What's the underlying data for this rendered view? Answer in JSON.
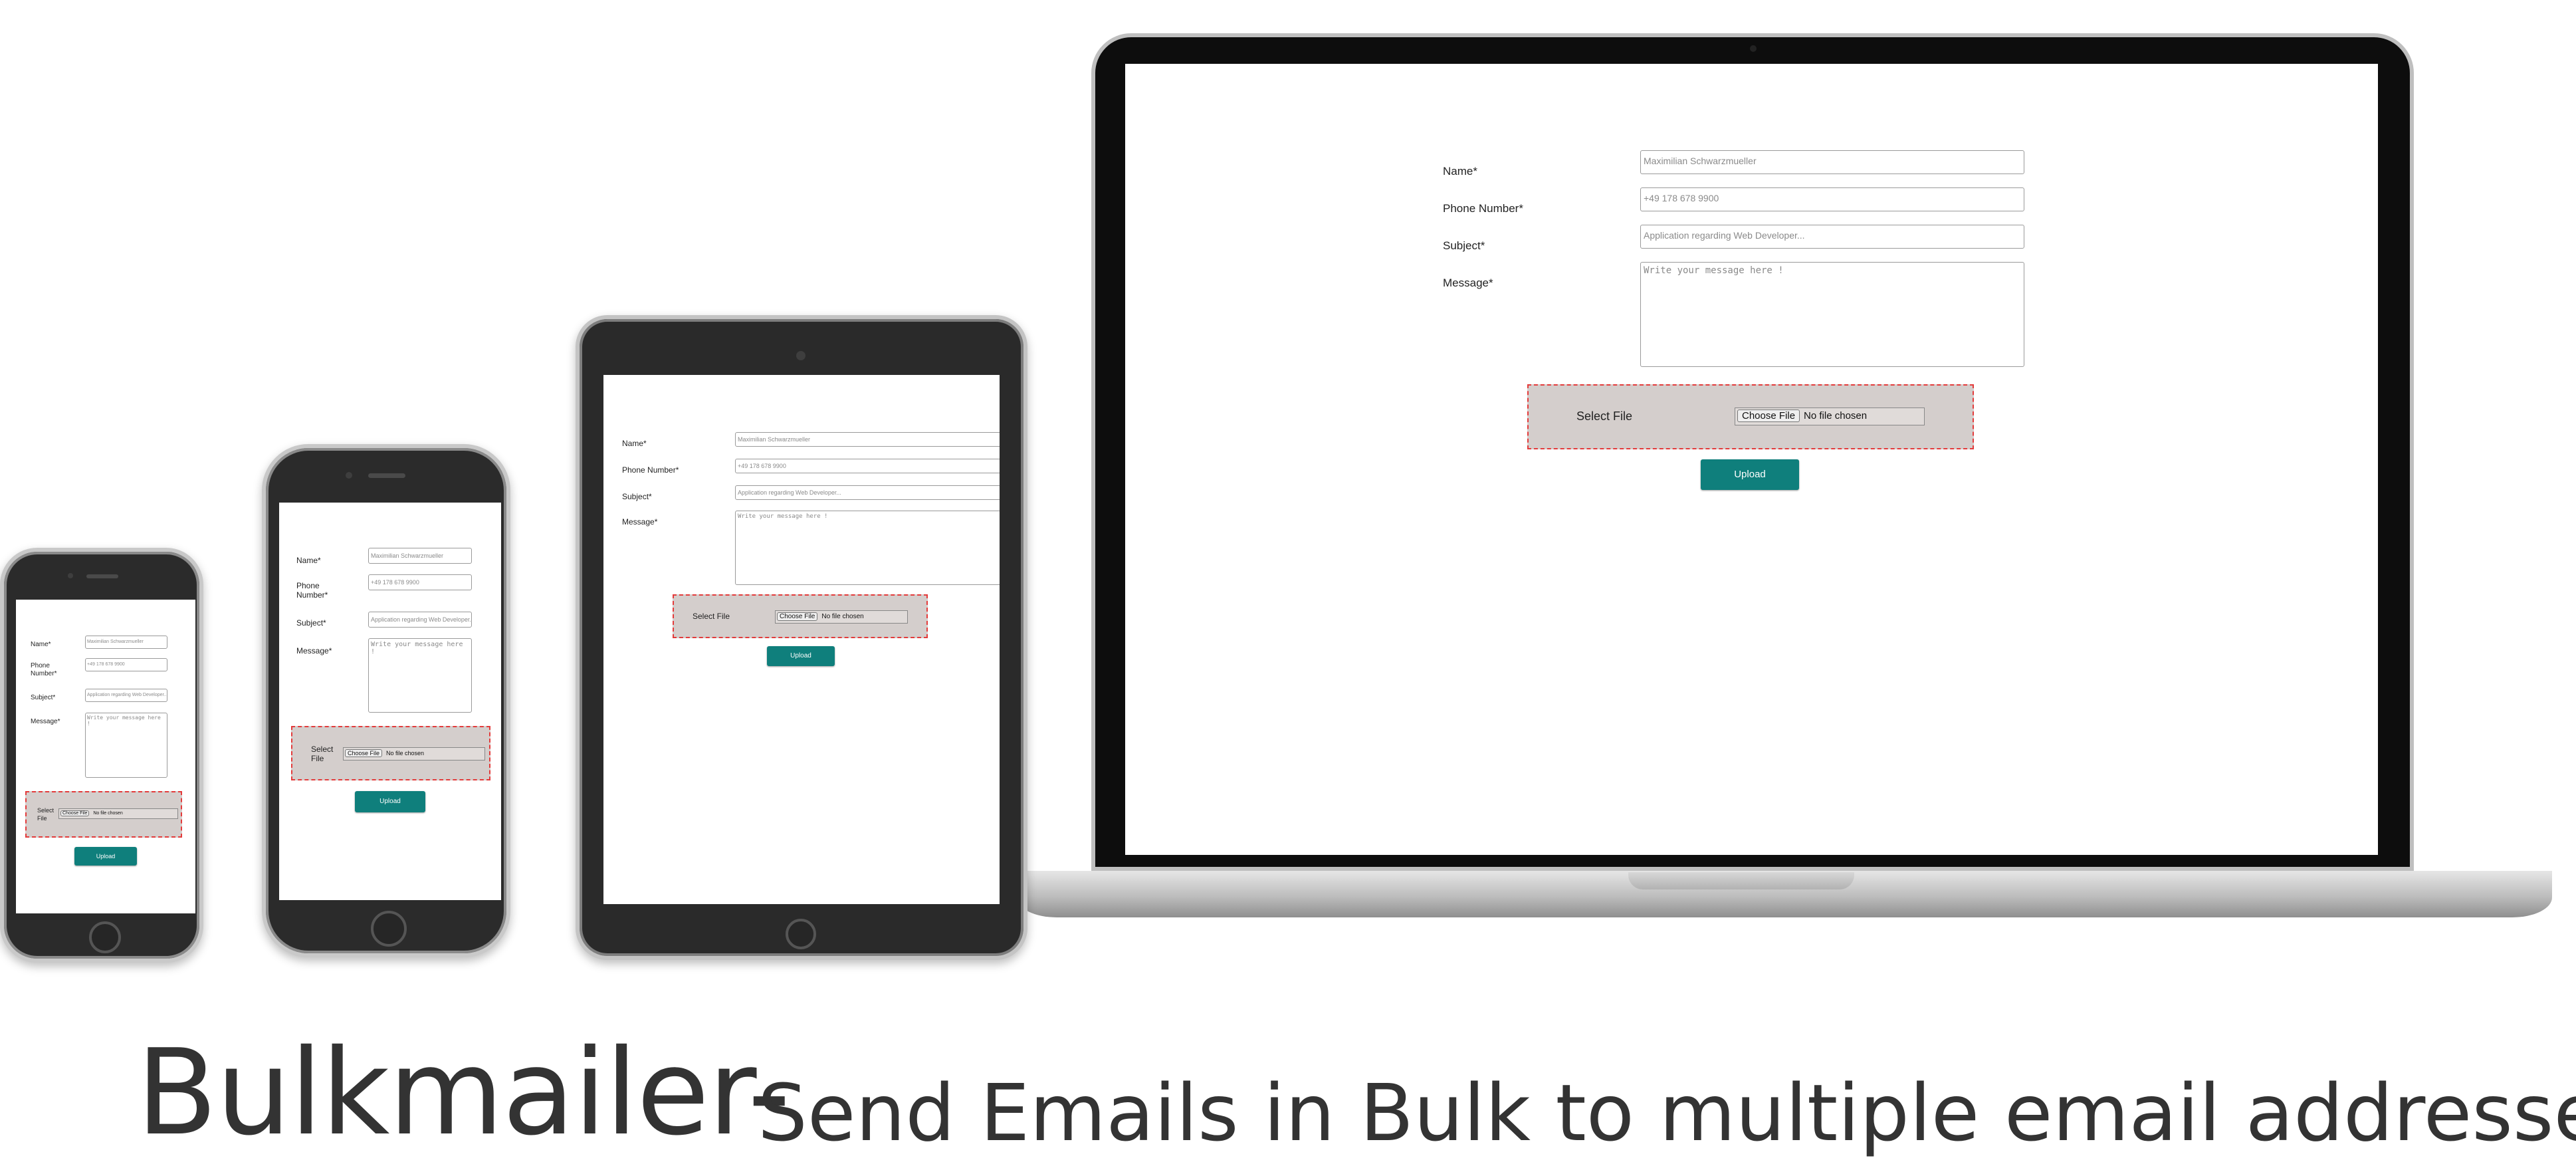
{
  "form": {
    "name_label": "Name*",
    "phone_label": "Phone Number*",
    "phone_label_line1": "Phone",
    "phone_label_line2": "Number*",
    "subject_label": "Subject*",
    "message_label": "Message*",
    "name_placeholder": "Maximilian Schwarzmueller",
    "phone_placeholder": "+49 178 678 9900",
    "subject_placeholder": "Application regarding Web Developer...",
    "message_placeholder": "Write your message here !",
    "select_file_label": "Select File",
    "select_label_line1": "Select",
    "select_label_line2": "File",
    "choose_file_button": "Choose File",
    "no_file_text": "No file chosen",
    "upload_button": "Upload"
  },
  "caption": {
    "title": "Bulkmailer-",
    "subtitle": "Send Emails in Bulk to multiple email addresses"
  },
  "colors": {
    "upload_button": "#0f7f7c",
    "file_zone_background": "#d4cecc",
    "file_zone_border": "#e33b3b",
    "caption_text": "#333333"
  }
}
